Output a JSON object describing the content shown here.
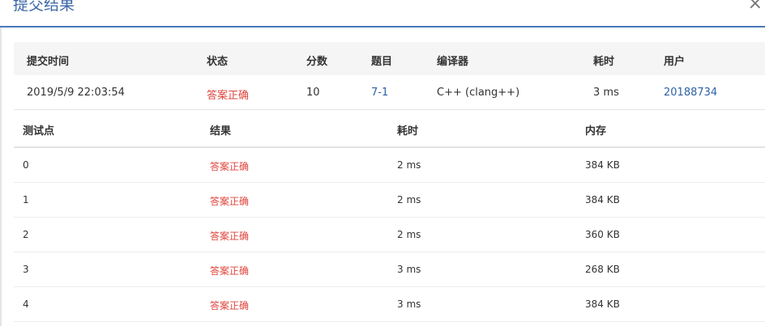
{
  "dialog": {
    "title": "提交结果",
    "close_glyph": "×"
  },
  "summary": {
    "headers": {
      "time": "提交时间",
      "status": "状态",
      "score": "分数",
      "problem": "题目",
      "compiler": "编译器",
      "elapsed": "耗时",
      "user": "用户"
    },
    "row": {
      "time": "2019/5/9 22:03:54",
      "status": "答案正确",
      "score": "10",
      "problem": "7-1",
      "compiler": "C++ (clang++)",
      "elapsed": "3 ms",
      "user": "20188734"
    }
  },
  "cases": {
    "headers": {
      "point": "测试点",
      "result": "结果",
      "elapsed": "耗时",
      "memory": "内存"
    },
    "rows": [
      {
        "point": "0",
        "result": "答案正确",
        "elapsed": "2 ms",
        "memory": "384 KB"
      },
      {
        "point": "1",
        "result": "答案正确",
        "elapsed": "2 ms",
        "memory": "384 KB"
      },
      {
        "point": "2",
        "result": "答案正确",
        "elapsed": "2 ms",
        "memory": "360 KB"
      },
      {
        "point": "3",
        "result": "答案正确",
        "elapsed": "3 ms",
        "memory": "268 KB"
      },
      {
        "point": "4",
        "result": "答案正确",
        "elapsed": "3 ms",
        "memory": "384 KB"
      }
    ]
  },
  "colors": {
    "accent": "#3b67a8",
    "success_red": "#e0443b",
    "link": "#2d62a7"
  }
}
